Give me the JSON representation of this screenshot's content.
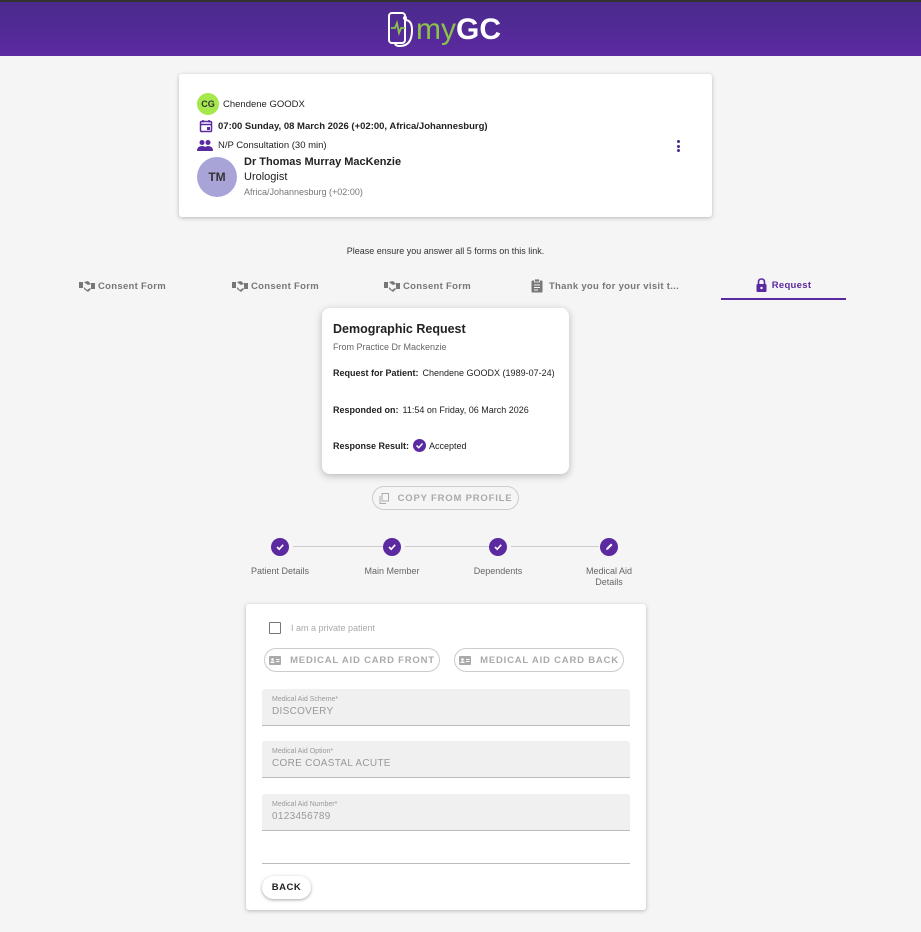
{
  "app": {
    "logo_prefix": "my",
    "logo_suffix": "GC",
    "brand_color": "#5b2aa0",
    "accent_color": "#8bc34a"
  },
  "appointment": {
    "patient_initials": "CG",
    "patient_name": "Chendene GOODX",
    "datetime": "07:00 Sunday, 08 March 2026 (+02:00, Africa/Johannesburg)",
    "consultation": "N/P Consultation (30 min)",
    "doctor_initials": "TM",
    "doctor_name": "Dr Thomas Murray MacKenzie",
    "doctor_specialty": "Urologist",
    "doctor_timezone": "Africa/Johannesburg (+02:00)"
  },
  "notice": "Please ensure you answer all 5 forms on this link.",
  "tabs": [
    {
      "label": "Consent Form",
      "icon": "handshake-icon"
    },
    {
      "label": "Consent Form",
      "icon": "handshake-icon"
    },
    {
      "label": "Consent Form",
      "icon": "handshake-icon"
    },
    {
      "label": "Thank you for your visit t...",
      "icon": "clipboard-icon"
    },
    {
      "label": "Request",
      "icon": "lock-icon",
      "active": true
    }
  ],
  "request_card": {
    "title": "Demographic Request",
    "subtitle": "From Practice Dr Mackenzie",
    "patient_label": "Request for Patient:",
    "patient_value": "Chendene GOODX (1989-07-24)",
    "responded_label": "Responded on:",
    "responded_value": "11:54 on Friday, 06 March 2026",
    "result_label": "Response Result:",
    "result_value": "Accepted"
  },
  "copy_button": "COPY FROM PROFILE",
  "stepper": {
    "steps": [
      {
        "label": "Patient Details",
        "state": "done"
      },
      {
        "label": "Main Member",
        "state": "done"
      },
      {
        "label": "Dependents",
        "state": "done"
      },
      {
        "label": "Medical Aid Details",
        "state": "editing"
      }
    ]
  },
  "form": {
    "private_patient_label": "I am a private patient",
    "card_front_button": "MEDICAL AID CARD FRONT",
    "card_back_button": "MEDICAL AID CARD BACK",
    "fields": [
      {
        "label": "Medical Aid Scheme*",
        "value": "DISCOVERY"
      },
      {
        "label": "Medical Aid Option*",
        "value": "CORE COASTAL ACUTE"
      },
      {
        "label": "Medical Aid Number*",
        "value": "0123456789"
      }
    ],
    "back_button": "BACK"
  }
}
